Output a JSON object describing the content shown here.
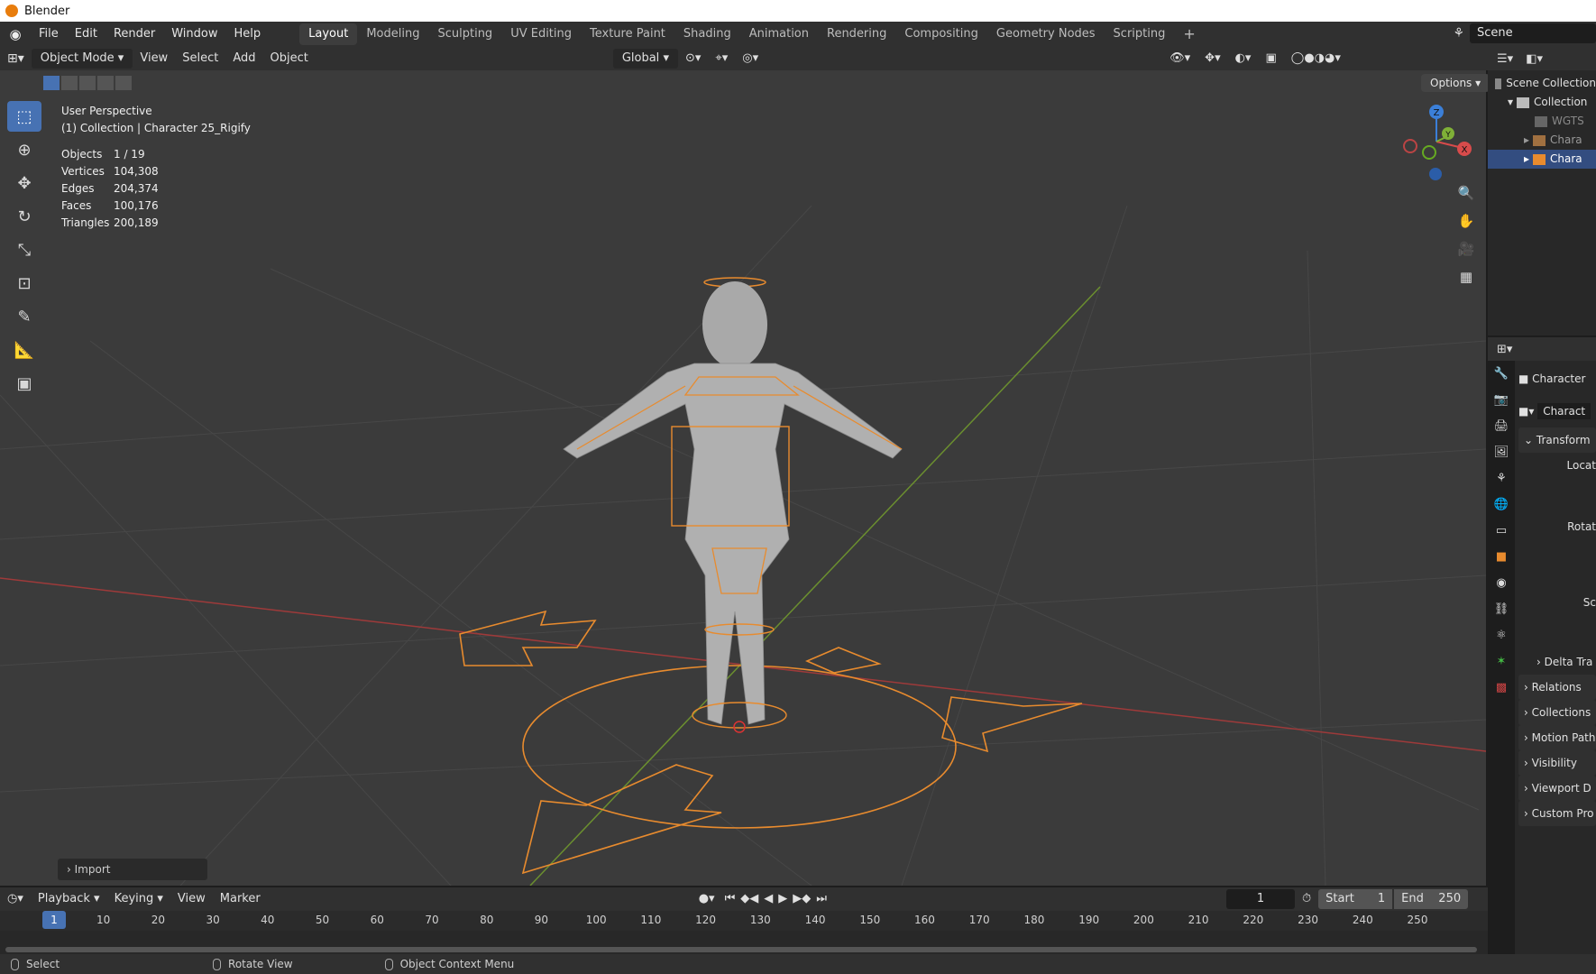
{
  "app": {
    "title": "Blender"
  },
  "menu": [
    "File",
    "Edit",
    "Render",
    "Window",
    "Help"
  ],
  "workspaces": [
    "Layout",
    "Modeling",
    "Sculpting",
    "UV Editing",
    "Texture Paint",
    "Shading",
    "Animation",
    "Rendering",
    "Compositing",
    "Geometry Nodes",
    "Scripting"
  ],
  "active_workspace": "Layout",
  "scene": {
    "name": "Scene"
  },
  "viewport_header": {
    "mode": "Object Mode",
    "menus": [
      "View",
      "Select",
      "Add",
      "Object"
    ],
    "orientation": "Global",
    "options": "Options"
  },
  "overlay": {
    "perspective": "User Perspective",
    "collection_line": "(1) Collection | Character 25_Rigify",
    "stats": [
      {
        "k": "Objects",
        "v": "1 / 19"
      },
      {
        "k": "Vertices",
        "v": "104,308"
      },
      {
        "k": "Edges",
        "v": "204,374"
      },
      {
        "k": "Faces",
        "v": "100,176"
      },
      {
        "k": "Triangles",
        "v": "200,189"
      }
    ]
  },
  "gizmo": {
    "x": "X",
    "y": "Y",
    "z": "Z"
  },
  "import_panel": "Import",
  "outliner": {
    "rows": [
      {
        "label": "Scene Collection",
        "indent": 0,
        "sel": false
      },
      {
        "label": "Collection",
        "indent": 1,
        "sel": false
      },
      {
        "label": "WGTS",
        "indent": 2,
        "sel": false
      },
      {
        "label": "Chara",
        "indent": 2,
        "sel": false
      },
      {
        "label": "Chara",
        "indent": 2,
        "sel": true
      }
    ]
  },
  "properties": {
    "object_name": "Character",
    "data_name": "Charact",
    "transform": "Transform",
    "fields": [
      "Locat",
      "Rotat",
      "Sc"
    ],
    "panels": [
      "Delta Tra",
      "Relations",
      "Collections",
      "Motion Path",
      "Visibility",
      "Viewport D",
      "Custom Pro"
    ]
  },
  "timeline": {
    "menus": [
      "Playback",
      "Keying",
      "View",
      "Marker"
    ],
    "current_frame": "1",
    "start_label": "Start",
    "start": "1",
    "end_label": "End",
    "end": "250",
    "ticks": [
      "1",
      "10",
      "20",
      "30",
      "40",
      "50",
      "60",
      "70",
      "80",
      "90",
      "100",
      "110",
      "120",
      "130",
      "140",
      "150",
      "160",
      "170",
      "180",
      "190",
      "200",
      "210",
      "220",
      "230",
      "240",
      "250"
    ]
  },
  "statusbar": {
    "items": [
      "Select",
      "Rotate View",
      "Object Context Menu"
    ]
  },
  "colors": {
    "selection": "#e88b2e",
    "accent": "#4772b3",
    "x_axis": "#9e3a3a",
    "y_axis": "#6b8f2f"
  }
}
